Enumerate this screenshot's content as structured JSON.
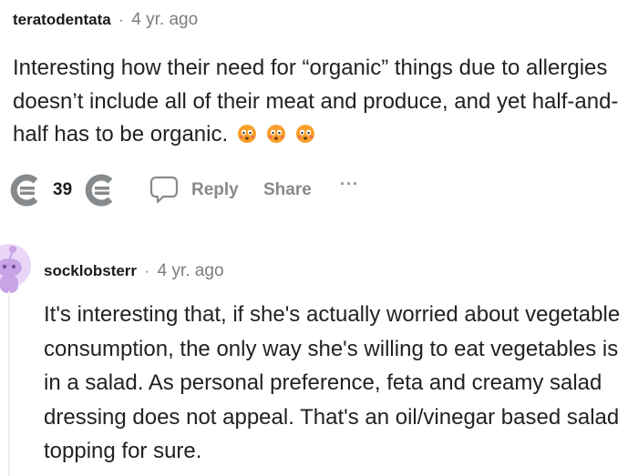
{
  "comment1": {
    "username": "teratodentata",
    "separator": "·",
    "time": "4 yr. ago",
    "body": "Interesting how their need for “organic” things due to allergies doesn’t include all of their meat and produce, and yet half-and-half has to be organic.",
    "emojis": [
      "flushed-face-emoji",
      "flushed-face-emoji",
      "flushed-face-emoji"
    ],
    "score": "39",
    "reply_label": "Reply",
    "share_label": "Share",
    "more_label": "···"
  },
  "comment2": {
    "username": "socklobsterr",
    "separator": "·",
    "time": "4 yr. ago",
    "body": "It's interesting that, if she's actually worried about vegetable consumption, the only way she's willing to eat vegetables is in a salad. As personal preference, feta and creamy salad dressing does not appeal. That's an oil/vinegar based salad topping for sure."
  },
  "colors": {
    "meta_gray": "#7c7c7c",
    "action_gray": "#878a8c",
    "avatar_purple": "#c8a4e6",
    "emoji_orange": "#f7a02a"
  }
}
